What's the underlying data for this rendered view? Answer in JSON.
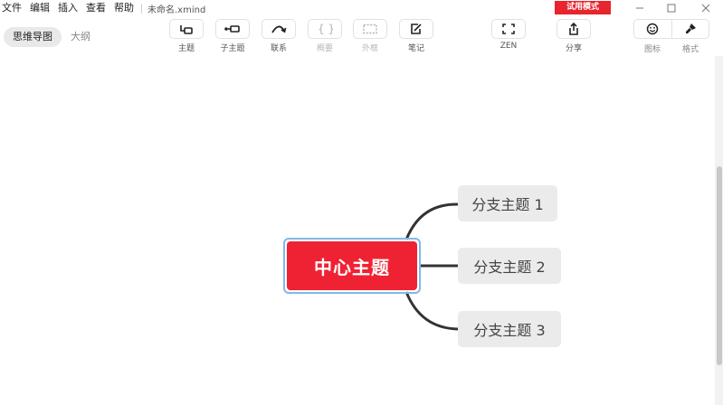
{
  "menu": {
    "items": [
      "文件",
      "编辑",
      "插入",
      "查看",
      "帮助"
    ],
    "filename": "未命名.xmind",
    "trial_badge": "试用模式"
  },
  "window_controls": {
    "minimize_icon": "minimize-icon",
    "maximize_icon": "maximize-icon",
    "close_icon": "close-icon"
  },
  "view_switch": {
    "mindmap": "思维导图",
    "outline": "大纲",
    "active": "思维导图"
  },
  "toolbar": {
    "topic": "主题",
    "subtopic": "子主题",
    "relationship": "联系",
    "summary": "概要",
    "boundary": "外框",
    "note": "笔记",
    "zen": "ZEN",
    "share": "分享",
    "icon": "图标",
    "format": "格式"
  },
  "mindmap": {
    "central": "中心主题",
    "branches": [
      "分支主题 1",
      "分支主题 2",
      "分支主题 3"
    ]
  },
  "colors": {
    "trial_badge": "#e8242c",
    "central_topic": "#ef2233",
    "selection_border": "#7fb9e6",
    "branch_fill": "#ebebeb",
    "connector": "#333333"
  }
}
